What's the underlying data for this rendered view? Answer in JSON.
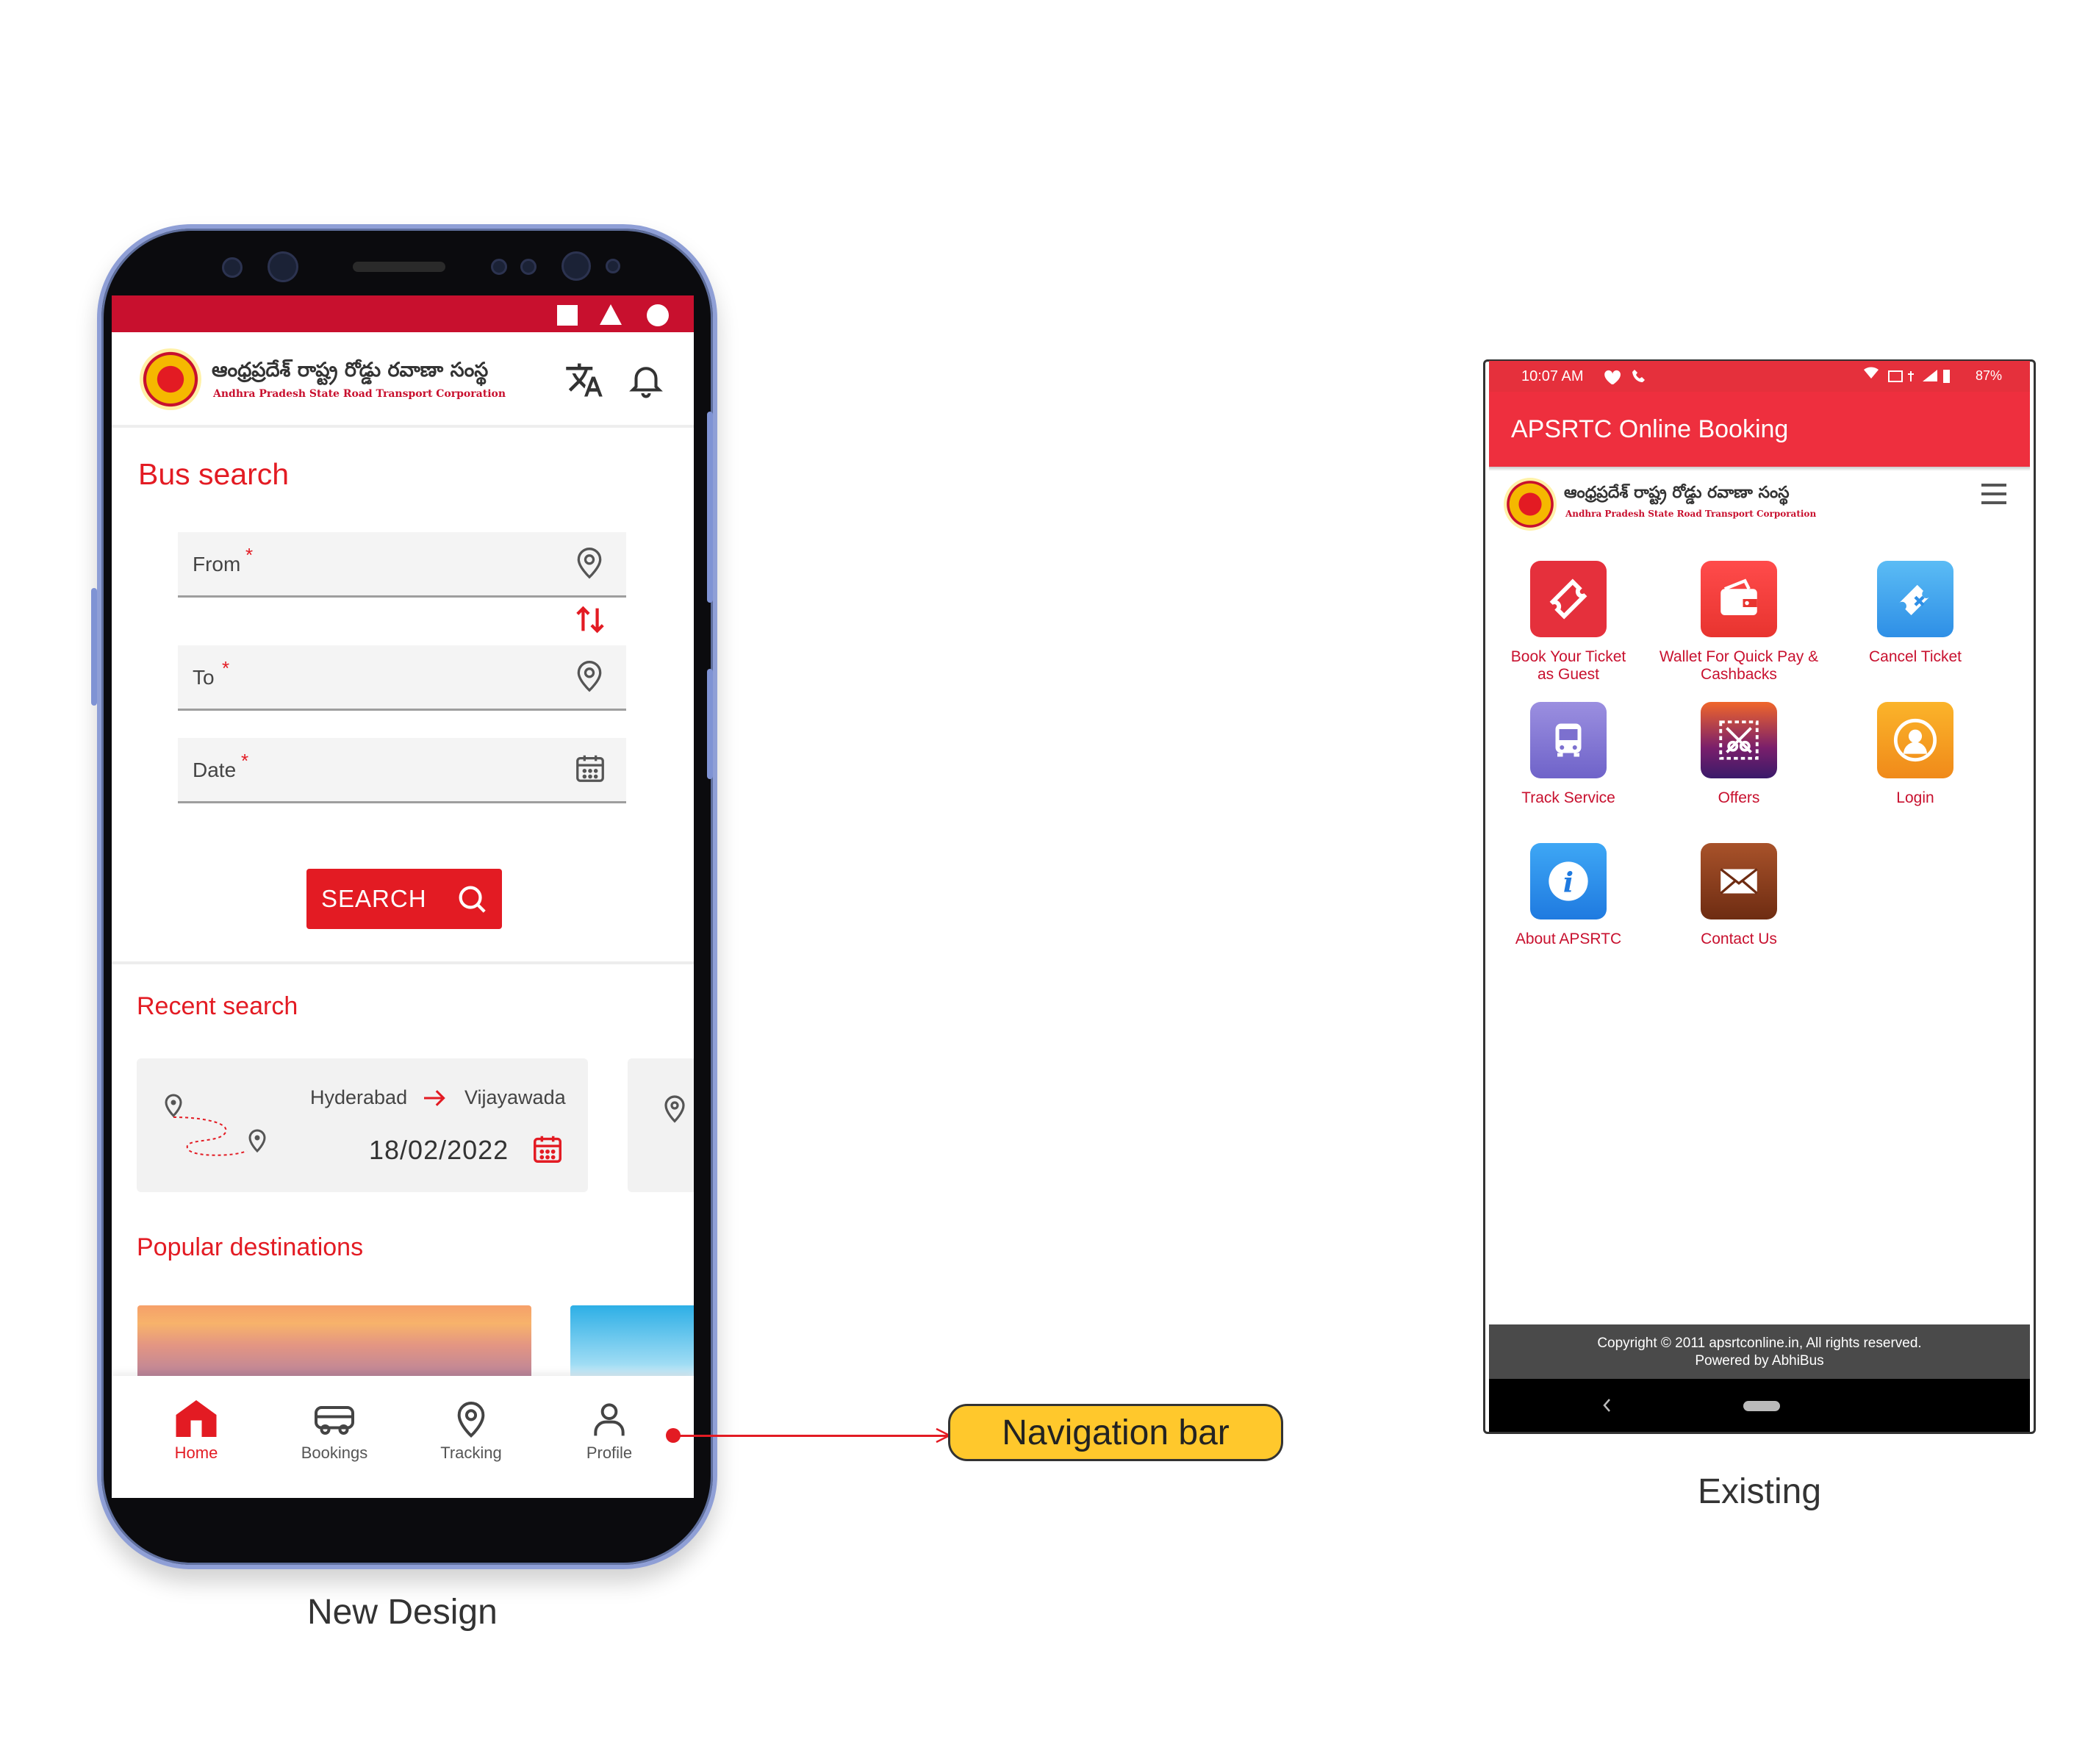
{
  "new_design": {
    "caption": "New Design",
    "header": {
      "org_name_telugu": "ఆంధ్రప్రదేశ్ రాష్ట్ర రోడ్డు రవాణా సంస్థ",
      "org_name_english": "Andhra Pradesh State Road Transport Corporation"
    },
    "bus_search": {
      "title": "Bus search",
      "from_label": "From",
      "to_label": "To",
      "date_label": "Date",
      "required_mark": "*",
      "search_button": "SEARCH"
    },
    "recent_search": {
      "title": "Recent search",
      "items": [
        {
          "from": "Hyderabad",
          "to": "Vijayawada",
          "date": "18/02/2022"
        }
      ]
    },
    "popular_destinations": {
      "title": "Popular destinations"
    },
    "nav": {
      "items": [
        {
          "label": "Home",
          "icon": "home-icon",
          "active": true
        },
        {
          "label": "Bookings",
          "icon": "bus-icon",
          "active": false
        },
        {
          "label": "Tracking",
          "icon": "location-pin-icon",
          "active": false
        },
        {
          "label": "Profile",
          "icon": "person-icon",
          "active": false
        }
      ]
    },
    "colors": {
      "accent": "#e31b23",
      "status_bar": "#c8102e"
    }
  },
  "callout": {
    "label": "Navigation bar",
    "color": "#ffc82c"
  },
  "existing": {
    "caption": "Existing",
    "status": {
      "time": "10:07 AM",
      "battery": "87%"
    },
    "app_title": "APSRTC Online Booking",
    "header": {
      "org_name_telugu": "ఆంధ్రప్రదేశ్ రాష్ట్ర రోడ్డు రవాణా సంస్థ",
      "org_name_english": "Andhra Pradesh State Road Transport Corporation"
    },
    "tiles": [
      {
        "label_line1": "Book Your Ticket",
        "label_line2": "as Guest",
        "icon": "ticket-icon",
        "color": "#e5303c"
      },
      {
        "label_line1": "Wallet For Quick Pay &",
        "label_line2": "Cashbacks",
        "icon": "wallet-icon",
        "color": "#f0433c"
      },
      {
        "label_line1": "Cancel Ticket",
        "label_line2": "",
        "icon": "cancel-ticket-icon",
        "color": "#3ea7ef"
      },
      {
        "label_line1": "Track Service",
        "label_line2": "",
        "icon": "bus-icon",
        "color": "#8a7fd6"
      },
      {
        "label_line1": "Offers",
        "label_line2": "",
        "icon": "offers-icon",
        "color": "#e0462a"
      },
      {
        "label_line1": "Login",
        "label_line2": "",
        "icon": "user-icon",
        "color": "#f6a21e"
      },
      {
        "label_line1": "About APSRTC",
        "label_line2": "",
        "icon": "info-icon",
        "color": "#2f8df0"
      },
      {
        "label_line1": "Contact Us",
        "label_line2": "",
        "icon": "mail-icon",
        "color": "#8b3d1c"
      }
    ],
    "footer": {
      "line1": "Copyright © 2011 apsrtconline.in, All rights reserved.",
      "line2": "Powered by AbhiBus"
    },
    "colors": {
      "app_bar": "#ee2f3e",
      "label": "#c8102e"
    }
  }
}
